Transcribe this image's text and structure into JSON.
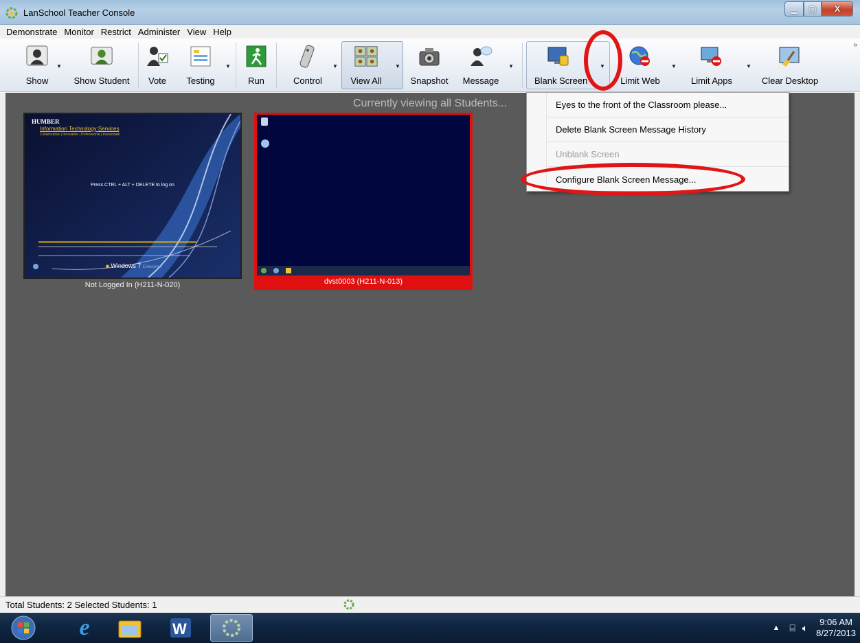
{
  "window": {
    "title": "LanSchool Teacher Console"
  },
  "menu": [
    "Demonstrate",
    "Monitor",
    "Restrict",
    "Administer",
    "View",
    "Help"
  ],
  "toolbar": {
    "show": "Show",
    "show_student": "Show Student",
    "vote": "Vote",
    "testing": "Testing",
    "run": "Run",
    "control": "Control",
    "view_all": "View All",
    "snapshot": "Snapshot",
    "message": "Message",
    "blank_screen": "Blank Screen",
    "limit_web": "Limit Web",
    "limit_apps": "Limit Apps",
    "clear_desktop": "Clear Desktop"
  },
  "main": {
    "banner": "Currently viewing all Students...",
    "students": [
      {
        "caption": "Not Logged In (H211-N-020)",
        "screen": {
          "org": "HUMBER",
          "dept": "Information Technology Services",
          "tagline": "Collaborative | Innovative | Professional | Passionate",
          "logon_msg": "Press CTRL + ALT + DELETE to log on",
          "os_label": "Windows 7",
          "os_edition": "Enterprise"
        }
      },
      {
        "caption": "dvst0003 (H211-N-013)",
        "screen": {}
      }
    ]
  },
  "dropdown": {
    "items": [
      {
        "label": "Eyes to the front of the Classroom please...",
        "enabled": true
      },
      {
        "label": "Delete Blank Screen Message History",
        "enabled": true
      },
      {
        "label": "Unblank Screen",
        "enabled": false
      },
      {
        "label": "Configure Blank Screen Message...",
        "enabled": true
      }
    ]
  },
  "status": {
    "text": "Total Students: 2  Selected Students: 1"
  },
  "taskbar": {
    "clock_time": "9:06 AM",
    "clock_date": "8/27/2013",
    "apps": [
      "windows-start-icon",
      "internet-explorer-icon",
      "file-explorer-icon",
      "word-icon",
      "lanschool-icon"
    ]
  },
  "colors": {
    "selected_border": "#e01010",
    "annotation": "#e01616",
    "workspace": "#5a5a5a"
  }
}
